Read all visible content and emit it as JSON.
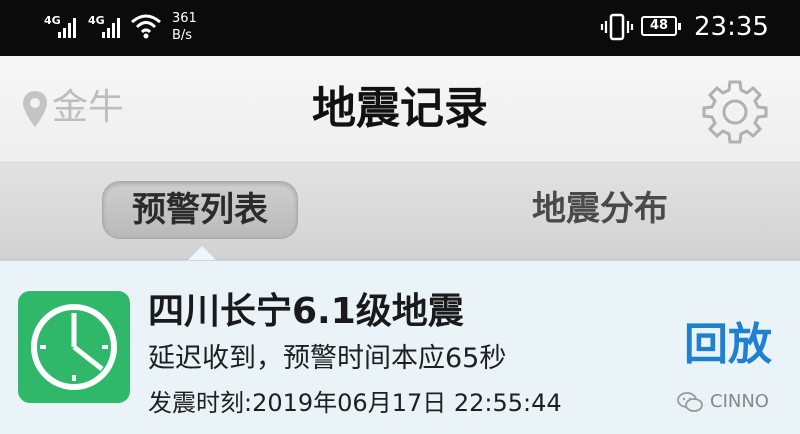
{
  "status_bar": {
    "signal1_tag": "4G",
    "signal2_tag": "4G",
    "net_speed_value": "361",
    "net_speed_unit": "B/s",
    "battery": "48",
    "time": "23:35",
    "icons": [
      "signal-icon",
      "signal-icon",
      "wifi-icon",
      "vibrate-icon",
      "battery-icon"
    ]
  },
  "header": {
    "location": "金牛",
    "title": "地震记录",
    "icons": [
      "location-pin-icon",
      "gear-icon"
    ]
  },
  "tabs": [
    {
      "label": "预警列表",
      "active": true
    },
    {
      "label": "地震分布",
      "active": false
    }
  ],
  "list": {
    "items": [
      {
        "title": "四川长宁6.1级地震",
        "delay": "延迟收到，预警时间本应65秒",
        "time": "发震时刻:2019年06月17日 22:55:44",
        "action": "回放",
        "icon": "alarm-clock-icon"
      }
    ]
  },
  "watermark": {
    "text": "CINNO",
    "icon": "wechat-icon"
  },
  "colors": {
    "status_bg": "#0b0b0b",
    "accent_blue": "#1f7fd0",
    "icon_green": "#2fb86a",
    "list_bg": "#e9f3f8"
  }
}
